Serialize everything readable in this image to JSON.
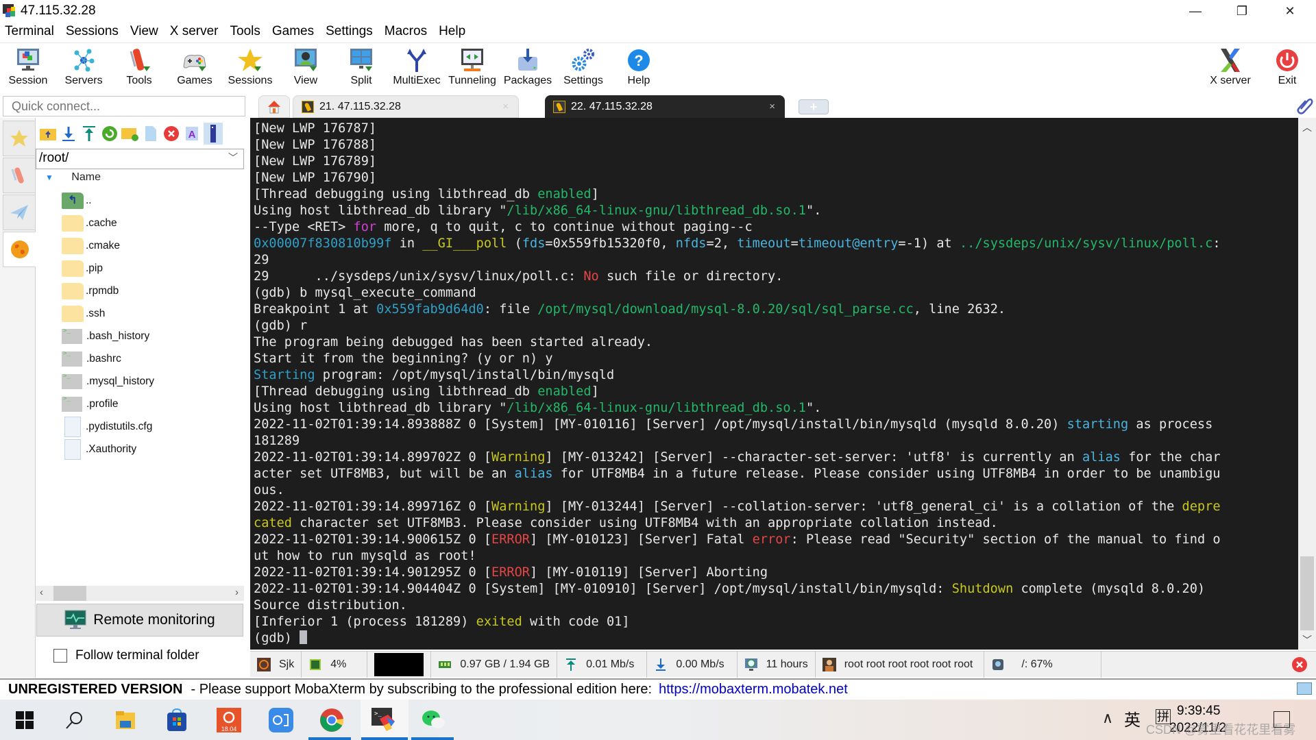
{
  "window": {
    "title": "47.115.32.28",
    "controls": {
      "minimize": "—",
      "maximize": "❐",
      "close": "✕"
    }
  },
  "menu": [
    "Terminal",
    "Sessions",
    "View",
    "X server",
    "Tools",
    "Games",
    "Settings",
    "Macros",
    "Help"
  ],
  "toolbar": {
    "left": [
      {
        "label": "Session",
        "icon": "session-icon"
      },
      {
        "label": "Servers",
        "icon": "servers-icon"
      },
      {
        "label": "Tools",
        "icon": "tools-icon"
      },
      {
        "label": "Games",
        "icon": "games-icon"
      },
      {
        "label": "Sessions",
        "icon": "sessions-star-icon"
      },
      {
        "label": "View",
        "icon": "view-icon"
      },
      {
        "label": "Split",
        "icon": "split-icon"
      },
      {
        "label": "MultiExec",
        "icon": "multiexec-icon"
      },
      {
        "label": "Tunneling",
        "icon": "tunneling-icon"
      },
      {
        "label": "Packages",
        "icon": "packages-icon"
      },
      {
        "label": "Settings",
        "icon": "settings-icon"
      },
      {
        "label": "Help",
        "icon": "help-icon"
      }
    ],
    "right": [
      {
        "label": "X server",
        "icon": "xserver-icon"
      },
      {
        "label": "Exit",
        "icon": "exit-icon"
      }
    ]
  },
  "quick_connect": {
    "placeholder": "Quick connect..."
  },
  "tabs": [
    {
      "label": "21. 47.115.32.28",
      "active": false,
      "close": "×"
    },
    {
      "label": "22. 47.115.32.28",
      "active": true,
      "close": "×"
    }
  ],
  "tab_add": "+",
  "sftp": {
    "path": "/root/",
    "column_header": "Name",
    "files": [
      {
        "name": "..",
        "type": "up"
      },
      {
        "name": ".cache",
        "type": "folder"
      },
      {
        "name": ".cmake",
        "type": "folder"
      },
      {
        "name": ".pip",
        "type": "folder"
      },
      {
        "name": ".rpmdb",
        "type": "folder"
      },
      {
        "name": ".ssh",
        "type": "folder"
      },
      {
        "name": ".bash_history",
        "type": "term"
      },
      {
        "name": ".bashrc",
        "type": "term"
      },
      {
        "name": ".mysql_history",
        "type": "term"
      },
      {
        "name": ".profile",
        "type": "term"
      },
      {
        "name": ".pydistutils.cfg",
        "type": "doc"
      },
      {
        "name": ".Xauthority",
        "type": "doc"
      }
    ],
    "remote_monitoring": "Remote monitoring",
    "follow_folder": "Follow terminal folder",
    "follow_folder_checked": false
  },
  "terminal": {
    "lines": [
      [
        {
          "t": "[New LWP 176787]"
        }
      ],
      [
        {
          "t": "[New LWP 176788]"
        }
      ],
      [
        {
          "t": "[New LWP 176789]"
        }
      ],
      [
        {
          "t": "[New LWP 176790]"
        }
      ],
      [
        {
          "t": "[Thread debugging using libthread_db "
        },
        {
          "t": "enabled",
          "c": "green"
        },
        {
          "t": "]"
        }
      ],
      [
        {
          "t": "Using host libthread_db library \""
        },
        {
          "t": "/lib/x86_64-linux-gnu/libthread_db.so.1",
          "c": "green"
        },
        {
          "t": "\"."
        }
      ],
      [
        {
          "t": "--Type <RET> "
        },
        {
          "t": "for",
          "c": "magenta"
        },
        {
          "t": " more, q to quit, c to continue without paging--c"
        }
      ],
      [
        {
          "t": "0x00007f830810b99f",
          "c": "blue"
        },
        {
          "t": " in "
        },
        {
          "t": "__GI___poll",
          "c": "yellow"
        },
        {
          "t": " ("
        },
        {
          "t": "fds",
          "c": "lblue"
        },
        {
          "t": "=0x559fb15320f0, "
        },
        {
          "t": "nfds",
          "c": "lblue"
        },
        {
          "t": "=2, "
        },
        {
          "t": "timeout",
          "c": "lblue"
        },
        {
          "t": "="
        },
        {
          "t": "timeout@entry",
          "c": "lblue"
        },
        {
          "t": "=-1) at "
        },
        {
          "t": "../sysdeps/unix/sysv/linux/poll.c",
          "c": "green"
        },
        {
          "t": ":"
        }
      ],
      [
        {
          "t": "29"
        }
      ],
      [
        {
          "t": "29      ../sysdeps/unix/sysv/linux/poll.c: "
        },
        {
          "t": "No",
          "c": "red"
        },
        {
          "t": " such file or directory."
        }
      ],
      [
        {
          "t": "(gdb) b mysql_execute_command"
        }
      ],
      [
        {
          "t": "Breakpoint 1 at "
        },
        {
          "t": "0x559fab9d64d0",
          "c": "blue"
        },
        {
          "t": ": file "
        },
        {
          "t": "/opt/mysql/download/mysql-8.0.20/sql/sql_parse.cc",
          "c": "green"
        },
        {
          "t": ", line 2632."
        }
      ],
      [
        {
          "t": "(gdb) r"
        }
      ],
      [
        {
          "t": "The program being debugged has been started already."
        }
      ],
      [
        {
          "t": "Start it from the beginning? (y or n) y"
        }
      ],
      [
        {
          "t": "Starting",
          "c": "blue"
        },
        {
          "t": " program: /opt/mysql/install/bin/mysqld"
        }
      ],
      [
        {
          "t": "[Thread debugging using libthread_db "
        },
        {
          "t": "enabled",
          "c": "green"
        },
        {
          "t": "]"
        }
      ],
      [
        {
          "t": "Using host libthread_db library \""
        },
        {
          "t": "/lib/x86_64-linux-gnu/libthread_db.so.1",
          "c": "green"
        },
        {
          "t": "\"."
        }
      ],
      [
        {
          "t": "2022-11-02T01:39:14.893888Z 0 [System] [MY-010116] [Server] /opt/mysql/install/bin/mysqld (mysqld 8.0.20) "
        },
        {
          "t": "starting",
          "c": "lblue"
        },
        {
          "t": " as process"
        }
      ],
      [
        {
          "t": "181289"
        }
      ],
      [
        {
          "t": "2022-11-02T01:39:14.899702Z 0 ["
        },
        {
          "t": "Warning",
          "c": "yellow"
        },
        {
          "t": "] [MY-013242] [Server] --character-set-server: 'utf8' is currently an "
        },
        {
          "t": "alias",
          "c": "lblue"
        },
        {
          "t": " for the char"
        }
      ],
      [
        {
          "t": "acter set UTF8MB3, but will be an "
        },
        {
          "t": "alias",
          "c": "lblue"
        },
        {
          "t": " for UTF8MB4 in a future release. Please consider using UTF8MB4 in order to be unambigu"
        }
      ],
      [
        {
          "t": "ous."
        }
      ],
      [
        {
          "t": "2022-11-02T01:39:14.899716Z 0 ["
        },
        {
          "t": "Warning",
          "c": "yellow"
        },
        {
          "t": "] [MY-013244] [Server] --collation-server: 'utf8_general_ci' is a collation of the "
        },
        {
          "t": "depre",
          "c": "yellow"
        }
      ],
      [
        {
          "t": "cated",
          "c": "yellow"
        },
        {
          "t": " character set UTF8MB3. Please consider using UTF8MB4 with an appropriate collation instead."
        }
      ],
      [
        {
          "t": "2022-11-02T01:39:14.900615Z 0 ["
        },
        {
          "t": "ERROR",
          "c": "red"
        },
        {
          "t": "] [MY-010123] [Server] Fatal "
        },
        {
          "t": "error",
          "c": "red"
        },
        {
          "t": ": Please read \"Security\" section of the manual to find o"
        }
      ],
      [
        {
          "t": "ut how to run mysqld as root!"
        }
      ],
      [
        {
          "t": "2022-11-02T01:39:14.901295Z 0 ["
        },
        {
          "t": "ERROR",
          "c": "red"
        },
        {
          "t": "] [MY-010119] [Server] Aborting"
        }
      ],
      [
        {
          "t": "2022-11-02T01:39:14.904404Z 0 [System] [MY-010910] [Server] /opt/mysql/install/bin/mysqld: "
        },
        {
          "t": "Shutdown",
          "c": "yellow"
        },
        {
          "t": " complete (mysqld 8.0.20)"
        }
      ],
      [
        {
          "t": "Source distribution."
        }
      ],
      [
        {
          "t": "[Inferior 1 (process 181289) "
        },
        {
          "t": "exited",
          "c": "yellow"
        },
        {
          "t": " with code 01]"
        }
      ],
      [
        {
          "t": "(gdb) "
        }
      ]
    ]
  },
  "statusbar": {
    "host": "Sjk",
    "cpu": "4%",
    "memory": "0.97 GB / 1.94 GB",
    "upload": "0.01 Mb/s",
    "download": "0.00 Mb/s",
    "uptime": "11 hours",
    "users": "root  root  root  root  root  root",
    "disk": "/: 67%"
  },
  "unregistered": {
    "title": "UNREGISTERED VERSION",
    "message": "-  Please support MobaXterm by subscribing to the professional edition here:",
    "link": "https://mobaxterm.mobatek.net"
  },
  "taskbar": {
    "apps": [
      "windows-start",
      "search",
      "file-explorer",
      "microsoft-store",
      "ubuntu-18.04",
      "dingtalk",
      "chrome",
      "mobaxterm",
      "wechat"
    ],
    "ubuntu_badge": "18.04",
    "tray": {
      "chevron": "∧",
      "ime_lang": "英",
      "ime_mode": "拼"
    },
    "time": "9:39:45",
    "date": "2022/11/2"
  },
  "watermark": "CSDN @雾里看花花里看雾"
}
